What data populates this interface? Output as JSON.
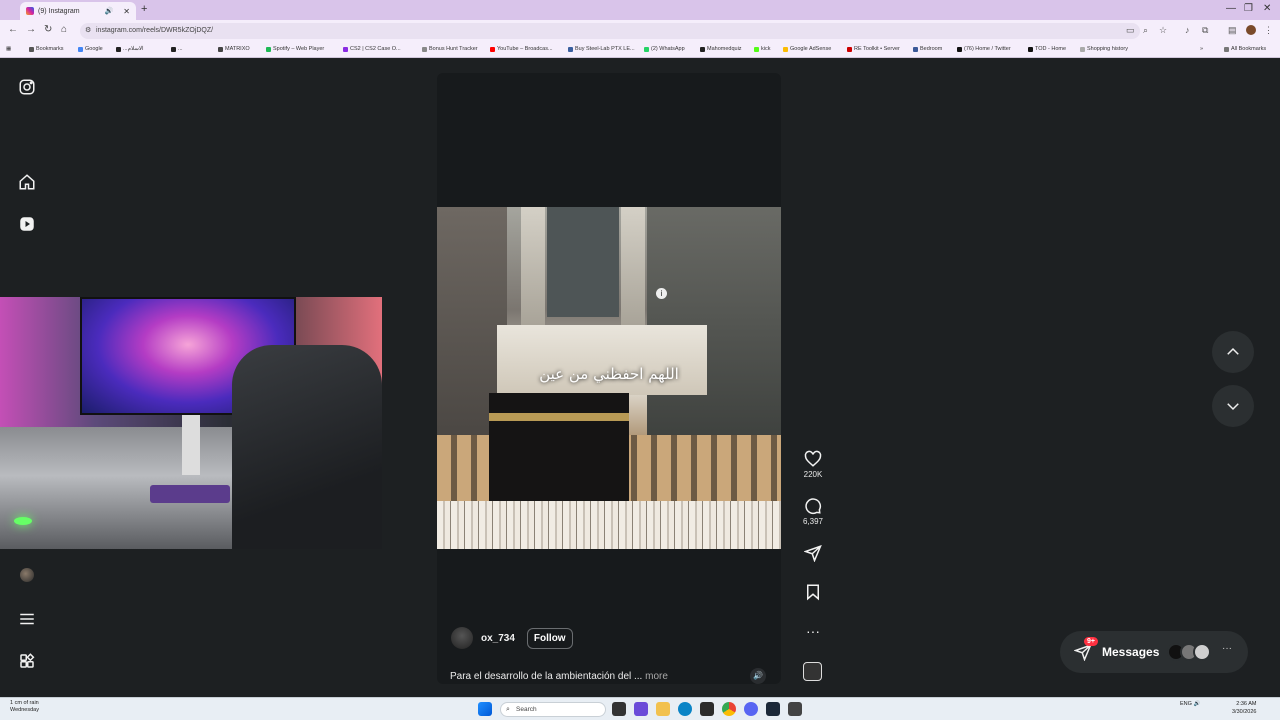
{
  "browser": {
    "tab_title": "(9) Instagram",
    "new_tab": "+",
    "url": "instagram.com/reels/DWR5kZOjDQZ/",
    "window_controls": [
      "—",
      "❐",
      "✕"
    ]
  },
  "bookmarks": [
    {
      "label": "Bookmarks",
      "color": "#555"
    },
    {
      "label": "Google",
      "color": "#4285f4"
    },
    {
      "label": "...الاسلام",
      "color": "#222"
    },
    {
      "label": "...",
      "color": "#222"
    },
    {
      "label": "MATRIXO",
      "color": "#444"
    },
    {
      "label": "Spotify – Web Player",
      "color": "#1db954"
    },
    {
      "label": "CS2 | CS2 Case O...",
      "color": "#8a2be2"
    },
    {
      "label": "Bonus Hunt Tracker",
      "color": "#888"
    },
    {
      "label": "YouTube – Broadcas...",
      "color": "#ff0000"
    },
    {
      "label": "Buy Steel-Lab PTX LE...",
      "color": "#3a5f9f"
    },
    {
      "label": "(2) WhatsApp",
      "color": "#25d366"
    },
    {
      "label": "Mahomedquiz",
      "color": "#222"
    },
    {
      "label": "kick",
      "color": "#53fc18"
    },
    {
      "label": "Google AdSense",
      "color": "#fbbc04"
    },
    {
      "label": "RE Toolkit • Server",
      "color": "#c00"
    },
    {
      "label": "Bedroom",
      "color": "#3b5998"
    },
    {
      "label": "(76) Home / Twitter",
      "color": "#111"
    },
    {
      "label": "TOD - Home",
      "color": "#111"
    },
    {
      "label": "Shopping history",
      "color": "#aaa"
    }
  ],
  "bookmarks_all": "All Bookmarks",
  "reel": {
    "caption_overlay": "اللهم احفظني من عين",
    "username": "ox_734",
    "follow_label": "Follow",
    "description": "Para el desarrollo de la ambientación del ...",
    "more_label": "more",
    "likes": "220K",
    "comments": "6,397"
  },
  "messages": {
    "label": "Messages",
    "badge": "9+"
  },
  "taskbar": {
    "weather_line1": "1 cm of rain",
    "weather_line2": "Wednesday",
    "search_placeholder": "Search",
    "lang": "ENG",
    "time": "2:36 AM",
    "date": "3/30/2026"
  }
}
